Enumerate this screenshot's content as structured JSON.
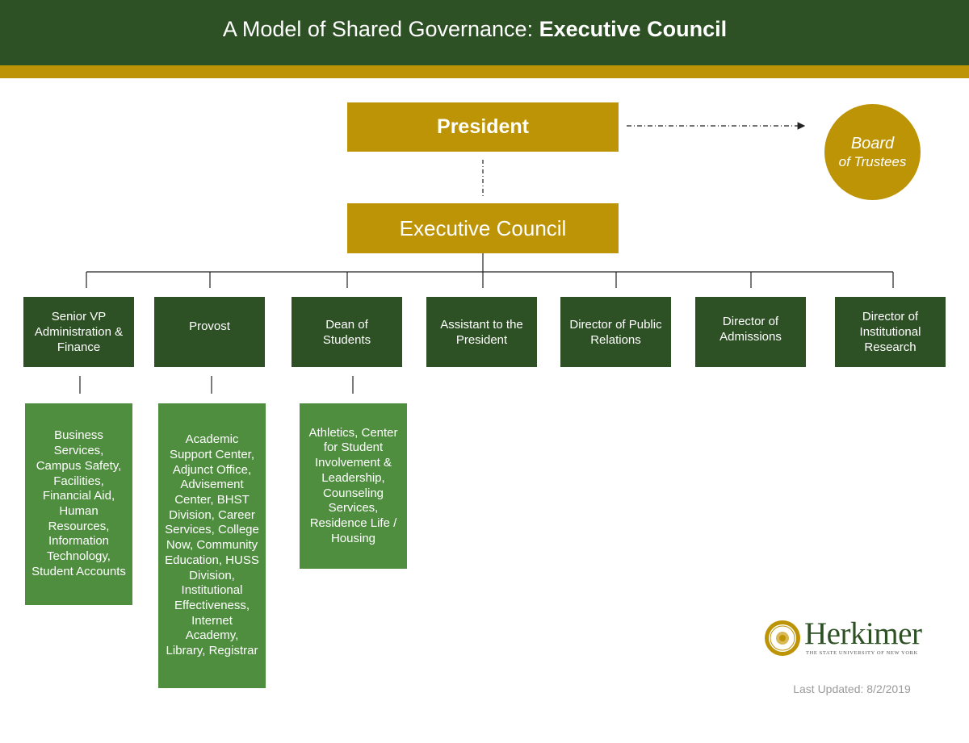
{
  "header": {
    "title_regular": "A Model of Shared Governance: ",
    "title_bold": "Executive Council"
  },
  "president": "President",
  "executive_council": "Executive Council",
  "board": {
    "line1": "Board",
    "line2": "of Trustees"
  },
  "departments": [
    {
      "label": "Senior VP Administration & Finance"
    },
    {
      "label": "Provost"
    },
    {
      "label": "Dean of Students"
    },
    {
      "label": "Assistant to the President"
    },
    {
      "label": "Director of Public Relations"
    },
    {
      "label": "Director of Admissions"
    },
    {
      "label": "Director of Institutional Research"
    }
  ],
  "units": [
    {
      "label": "Business Services, Campus Safety, Facilities, Financial Aid, Human Resources, Information Technology, Student Accounts"
    },
    {
      "label": "Academic Support Center, Adjunct Office, Advisement Center, BHST Division, Career Services, College Now, Community Education, HUSS Division, Institutional Effectiveness, Internet Academy, Library, Registrar"
    },
    {
      "label": "Athletics, Center for Student Involvement & Leadership, Counseling Services, Residence Life / Housing"
    }
  ],
  "logo": {
    "wordmark": "Herkimer",
    "subtitle": "THE STATE UNIVERSITY OF NEW YORK"
  },
  "last_updated": "Last Updated: 8/2/2019",
  "colors": {
    "dark_green": "#2e5025",
    "gold": "#bd9406",
    "mid_green": "#4f8e3f"
  }
}
